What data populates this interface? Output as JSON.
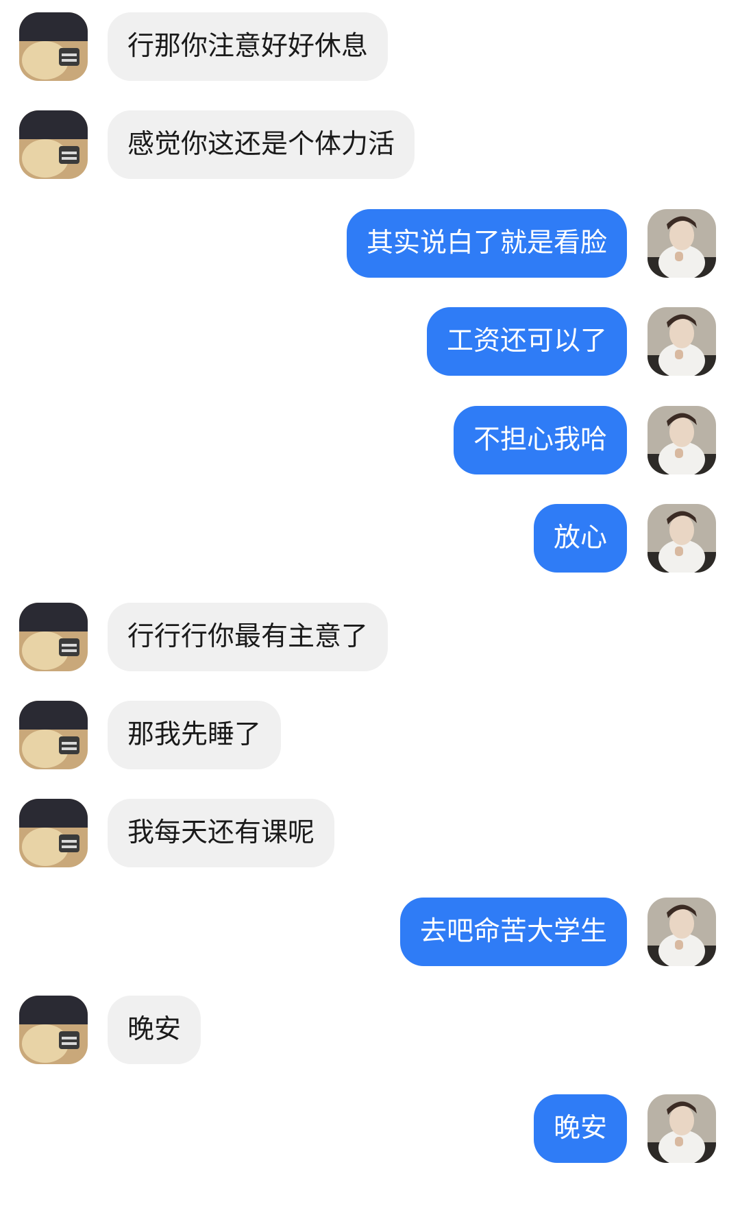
{
  "messages": [
    {
      "side": "in",
      "text": "行那你注意好好休息",
      "avatar": "other-user-avatar"
    },
    {
      "side": "in",
      "text": "感觉你这还是个体力活",
      "avatar": "other-user-avatar"
    },
    {
      "side": "out",
      "text": "其实说白了就是看脸",
      "avatar": "self-avatar"
    },
    {
      "side": "out",
      "text": "工资还可以了",
      "avatar": "self-avatar"
    },
    {
      "side": "out",
      "text": "不担心我哈",
      "avatar": "self-avatar"
    },
    {
      "side": "out",
      "text": "放心",
      "avatar": "self-avatar"
    },
    {
      "side": "in",
      "text": "行行行你最有主意了",
      "avatar": "other-user-avatar"
    },
    {
      "side": "in",
      "text": "那我先睡了",
      "avatar": "other-user-avatar"
    },
    {
      "side": "in",
      "text": "我每天还有课呢",
      "avatar": "other-user-avatar"
    },
    {
      "side": "out",
      "text": "去吧命苦大学生",
      "avatar": "self-avatar"
    },
    {
      "side": "in",
      "text": "晚安",
      "avatar": "other-user-avatar"
    },
    {
      "side": "out",
      "text": "晚安",
      "avatar": "self-avatar"
    }
  ],
  "colors": {
    "incoming_bubble": "#f0f0f0",
    "outgoing_bubble": "#2f7cf6",
    "incoming_text": "#1a1a1a",
    "outgoing_text": "#ffffff"
  }
}
